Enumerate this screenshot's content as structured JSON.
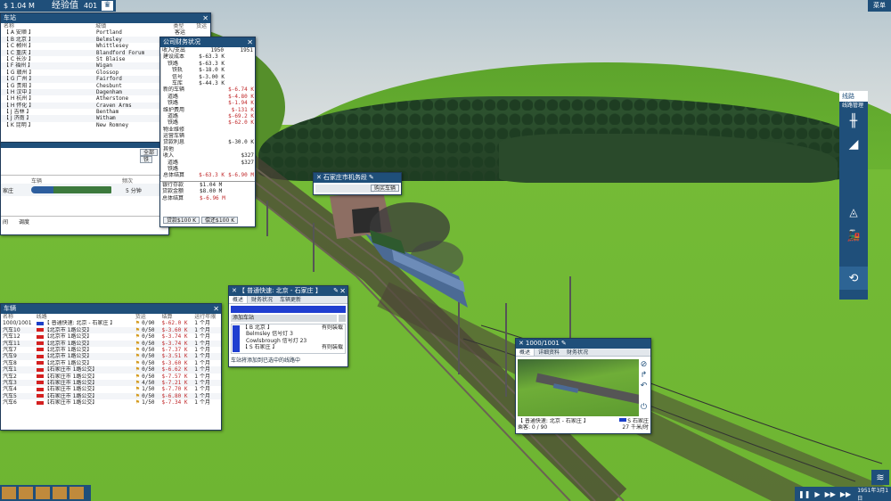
{
  "topbar": {
    "money": "$ 1.04 M",
    "exp_label": "经验值",
    "exp_value": "401",
    "menu": "菜单"
  },
  "stations": {
    "title": "车站",
    "headers": [
      "名称",
      "城镇",
      "类型",
      "货运"
    ],
    "rows": [
      {
        "code": "【 A 安顺 】",
        "town": "Portland",
        "type": "客运"
      },
      {
        "code": "【 B 北京 】",
        "town": "Belmsley",
        "type": "客运"
      },
      {
        "code": "【 C 郴州 】",
        "town": "Whittlesey",
        "type": ""
      },
      {
        "code": "【 C 重庆 】",
        "town": "Blandford Forum",
        "type": ""
      },
      {
        "code": "【 C 长沙 】",
        "town": "St Blaise",
        "type": ""
      },
      {
        "code": "【 F 福州 】",
        "town": "Wigan",
        "type": ""
      },
      {
        "code": "【 G 赣州 】",
        "town": "Glossop",
        "type": ""
      },
      {
        "code": "【 G 广州 】",
        "town": "Fairford",
        "type": ""
      },
      {
        "code": "【 G 贵阳 】",
        "town": "Chesbunt",
        "type": ""
      },
      {
        "code": "【 H 汉中 】",
        "town": "Dagenham",
        "type": ""
      },
      {
        "code": "【 H 杭州 】",
        "town": "Atherstone",
        "type": ""
      },
      {
        "code": "【 H 怀化 】",
        "town": "Craven Arms",
        "type": ""
      },
      {
        "code": "【 J 吉林 】",
        "town": "Bentham",
        "type": ""
      },
      {
        "code": "【 J 济南 】",
        "town": "Witham",
        "type": ""
      },
      {
        "code": "【 K 昆明 】",
        "town": "New Romney",
        "type": ""
      }
    ]
  },
  "depot": {
    "filter_all": "全部",
    "filter_second": "铁",
    "hdr_freq": "频次",
    "label_station": "家庄",
    "freq": "5 分钟",
    "footer_left": "间",
    "footer_btn": "调度"
  },
  "finance": {
    "title": "公司财务状况",
    "col_head": "收入/支出",
    "years": [
      "1950",
      "1951"
    ],
    "rows": [
      {
        "label": "建设成本",
        "v1": "$-63.3 K",
        "v2": "",
        "ind": 0,
        "red1": false,
        "red2": false
      },
      {
        "label": "铁路",
        "v1": "$-63.3 K",
        "v2": "",
        "ind": 1,
        "red1": false,
        "red2": false
      },
      {
        "label": "铁轨",
        "v1": "$-18.0 K",
        "v2": "",
        "ind": 2,
        "red1": false,
        "red2": false
      },
      {
        "label": "信号",
        "v1": "$-3.00 K",
        "v2": "",
        "ind": 2,
        "red1": false,
        "red2": false
      },
      {
        "label": "车库",
        "v1": "$-44.3 K",
        "v2": "",
        "ind": 2,
        "red1": false,
        "red2": false
      },
      {
        "label": "新的车辆",
        "v1": "",
        "v2": "$-6.74 K",
        "ind": 0,
        "red1": false,
        "red2": true
      },
      {
        "label": "道路",
        "v1": "",
        "v2": "$-4.80 K",
        "ind": 1,
        "red1": false,
        "red2": true
      },
      {
        "label": "铁路",
        "v1": "",
        "v2": "$-1.94 K",
        "ind": 1,
        "red1": false,
        "red2": true
      },
      {
        "label": "维护费用",
        "v1": "",
        "v2": "$-131 K",
        "ind": 0,
        "red1": false,
        "red2": true
      },
      {
        "label": "道路",
        "v1": "",
        "v2": "$-69.2 K",
        "ind": 1,
        "red1": false,
        "red2": true
      },
      {
        "label": "铁路",
        "v1": "",
        "v2": "$-62.0 K",
        "ind": 1,
        "red1": false,
        "red2": true
      },
      {
        "label": "物业维修",
        "v1": "",
        "v2": "",
        "ind": 0,
        "red1": false,
        "red2": false
      },
      {
        "label": "运营车辆",
        "v1": "",
        "v2": "",
        "ind": 0,
        "red1": false,
        "red2": false
      },
      {
        "label": "贷款利息",
        "v1": "",
        "v2": "$-30.0 K",
        "ind": 0,
        "red1": false,
        "red2": false
      },
      {
        "label": "其他",
        "v1": "",
        "v2": "",
        "ind": 0,
        "red1": false,
        "red2": false
      },
      {
        "label": "收入",
        "v1": "",
        "v2": "$327",
        "ind": 0,
        "red1": false,
        "red2": false
      },
      {
        "label": "道路",
        "v1": "",
        "v2": "$327",
        "ind": 1,
        "red1": false,
        "red2": false
      },
      {
        "label": "铁路",
        "v1": "",
        "v2": "",
        "ind": 1,
        "red1": false,
        "red2": false
      },
      {
        "label": "总体结算",
        "v1": "$-63.3 K",
        "v2": "$-6.90 M",
        "ind": 0,
        "red1": true,
        "red2": true
      }
    ],
    "bank_label": "银行存款",
    "bank": "$1.04 M",
    "loan_label": "贷款金额",
    "loan": "$8.00 M",
    "total_label": "总体结算",
    "total": "$-6.96 M",
    "btn_loan": "贷款$100 K",
    "btn_repay": "偿还$100 K"
  },
  "station_popup": {
    "title": "石家庄市机务段",
    "btn": "购买车辆"
  },
  "vehicles": {
    "title": "车辆",
    "headers": [
      "名称",
      "线路",
      "货运",
      "结算",
      "运行年限"
    ],
    "rows": [
      {
        "name": "1000/1001",
        "color": "#1c3fc8",
        "line": "【 普通快速: 北京 - 石家庄 】",
        "cargo": "0/90",
        "result": "$-62.0 K",
        "age": "1 个月"
      },
      {
        "name": "汽车10",
        "color": "#d42020",
        "line": "【北京市 1路公交】",
        "cargo": "0/50",
        "result": "$-3.60 K",
        "age": "1 个月"
      },
      {
        "name": "汽车12",
        "color": "#d42020",
        "line": "【北京市 1路公交】",
        "cargo": "0/50",
        "result": "$-3.74 K",
        "age": "1 个月"
      },
      {
        "name": "汽车11",
        "color": "#d42020",
        "line": "【北京市 1路公交】",
        "cargo": "0/50",
        "result": "$-3.74 K",
        "age": "1 个月"
      },
      {
        "name": "汽车7",
        "color": "#d42020",
        "line": "【北京市 1路公交】",
        "cargo": "0/50",
        "result": "$-7.37 K",
        "age": "1 个月"
      },
      {
        "name": "汽车9",
        "color": "#d42020",
        "line": "【北京市 1路公交】",
        "cargo": "0/50",
        "result": "$-3.51 K",
        "age": "1 个月"
      },
      {
        "name": "汽车8",
        "color": "#d42020",
        "line": "【北京市 1路公交】",
        "cargo": "0/50",
        "result": "$-3.60 K",
        "age": "1 个月"
      },
      {
        "name": "汽车1",
        "color": "#d42020",
        "line": "【石家庄市 1路公交】",
        "cargo": "0/50",
        "result": "$-6.62 K",
        "age": "1 个月"
      },
      {
        "name": "汽车2",
        "color": "#d42020",
        "line": "【石家庄市 1路公交】",
        "cargo": "0/50",
        "result": "$-7.57 K",
        "age": "1 个月"
      },
      {
        "name": "汽车3",
        "color": "#d42020",
        "line": "【石家庄市 1路公交】",
        "cargo": "4/50",
        "result": "$-7.21 K",
        "age": "1 个月"
      },
      {
        "name": "汽车4",
        "color": "#d42020",
        "line": "【石家庄市 1路公交】",
        "cargo": "1/50",
        "result": "$-7.70 K",
        "age": "1 个月"
      },
      {
        "name": "汽车5",
        "color": "#d42020",
        "line": "【石家庄市 1路公交】",
        "cargo": "0/50",
        "result": "$-6.80 K",
        "age": "1 个月"
      },
      {
        "name": "汽车6",
        "color": "#d42020",
        "line": "【石家庄市 1路公交】",
        "cargo": "1/50",
        "result": "$-7.34 K",
        "age": "1 个月"
      }
    ]
  },
  "line": {
    "title": "【 普通快速: 北京 - 石家庄 】",
    "tabs": [
      "概述",
      "财务状况",
      "车辆更新"
    ],
    "add_station": "添加车站",
    "stops": [
      {
        "name": "【 B 北京 】",
        "mode": "有则装载"
      },
      {
        "name": "Belmsley 信号灯 3",
        "mode": ""
      },
      {
        "name": "Cowlsbrough 信号灯 23",
        "mode": ""
      },
      {
        "name": "【 S 石家庄 】",
        "mode": "有则装载"
      }
    ],
    "hint": "车站将添加到已选中的线路中"
  },
  "vehicle": {
    "title": "1000/1001",
    "tabs": [
      "概述",
      "详细资料",
      "财务状况"
    ],
    "line_name": "【 普通快速: 北京 - 石家庄 】",
    "dest": "S 石家庄",
    "passengers": "乘客: 0 / 90",
    "speed": "27 千米/时"
  },
  "route_panel": {
    "title": "线路",
    "sub": "线路管理"
  },
  "bottom": {
    "date": "1951年3月1日"
  },
  "colors": {
    "title": "#1f4f7a",
    "red": "#c0282a",
    "blue": "#1c3fc8"
  }
}
